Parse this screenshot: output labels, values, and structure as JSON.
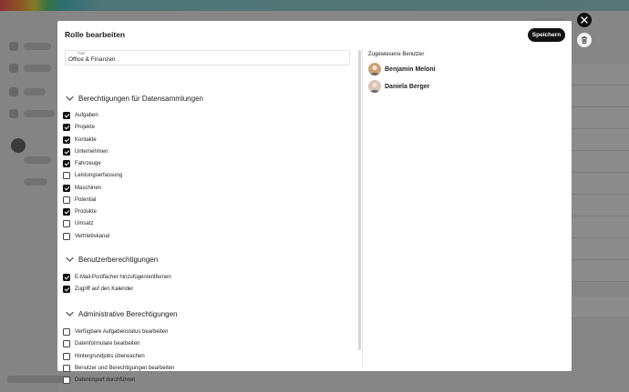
{
  "modal": {
    "title": "Rolle bearbeiten",
    "save_label": "Speichern",
    "title_field": {
      "label": "Titel",
      "value": "Office & Finanzen"
    }
  },
  "sections": [
    {
      "title": "Berechtigungen für Datensammlungen",
      "items": [
        {
          "label": "Aufgaben",
          "checked": true
        },
        {
          "label": "Projekte",
          "checked": true
        },
        {
          "label": "Kontakte",
          "checked": true
        },
        {
          "label": "Unternehmen",
          "checked": true
        },
        {
          "label": "Fahrzeuge",
          "checked": true
        },
        {
          "label": "Leistungserfassung",
          "checked": false
        },
        {
          "label": "Maschinen",
          "checked": true
        },
        {
          "label": "Potential",
          "checked": false
        },
        {
          "label": "Produkte",
          "checked": true
        },
        {
          "label": "Umsatz",
          "checked": false
        },
        {
          "label": "Vertriebskanal",
          "checked": false
        }
      ]
    },
    {
      "title": "Benutzerberechtigungen",
      "items": [
        {
          "label": "E-Mail-Postfächer hinzufügen/entfernen",
          "checked": true
        },
        {
          "label": "Zugriff auf den Kalender",
          "checked": true
        }
      ]
    },
    {
      "title": "Administrative Berechtigungen",
      "items": [
        {
          "label": "Verfügbare Aufgabenstatus bearbeiten",
          "checked": false
        },
        {
          "label": "Datenformulare bearbeiten",
          "checked": false
        },
        {
          "label": "Hintergrundjobs überwachen",
          "checked": false
        },
        {
          "label": "Benutzer und Berechtigungen bearbeiten",
          "checked": false
        },
        {
          "label": "Datenimport durchführen",
          "checked": false
        }
      ]
    }
  ],
  "assigned_users": {
    "title": "Zugewiesene Benutzer",
    "users": [
      {
        "name": "Benjamin Meloni",
        "avatar_icon": "user-avatar-icon",
        "avatar_color": "#c9a27a"
      },
      {
        "name": "Daniela Berger",
        "avatar_icon": "user-avatar-icon",
        "avatar_color": "#d9c4b8"
      }
    ]
  },
  "controls": {
    "close_icon": "close-icon",
    "delete_icon": "trash-icon"
  },
  "colors": {
    "primary_button": "#111111",
    "overlay": "rgba(0,0,0,0.45)"
  }
}
